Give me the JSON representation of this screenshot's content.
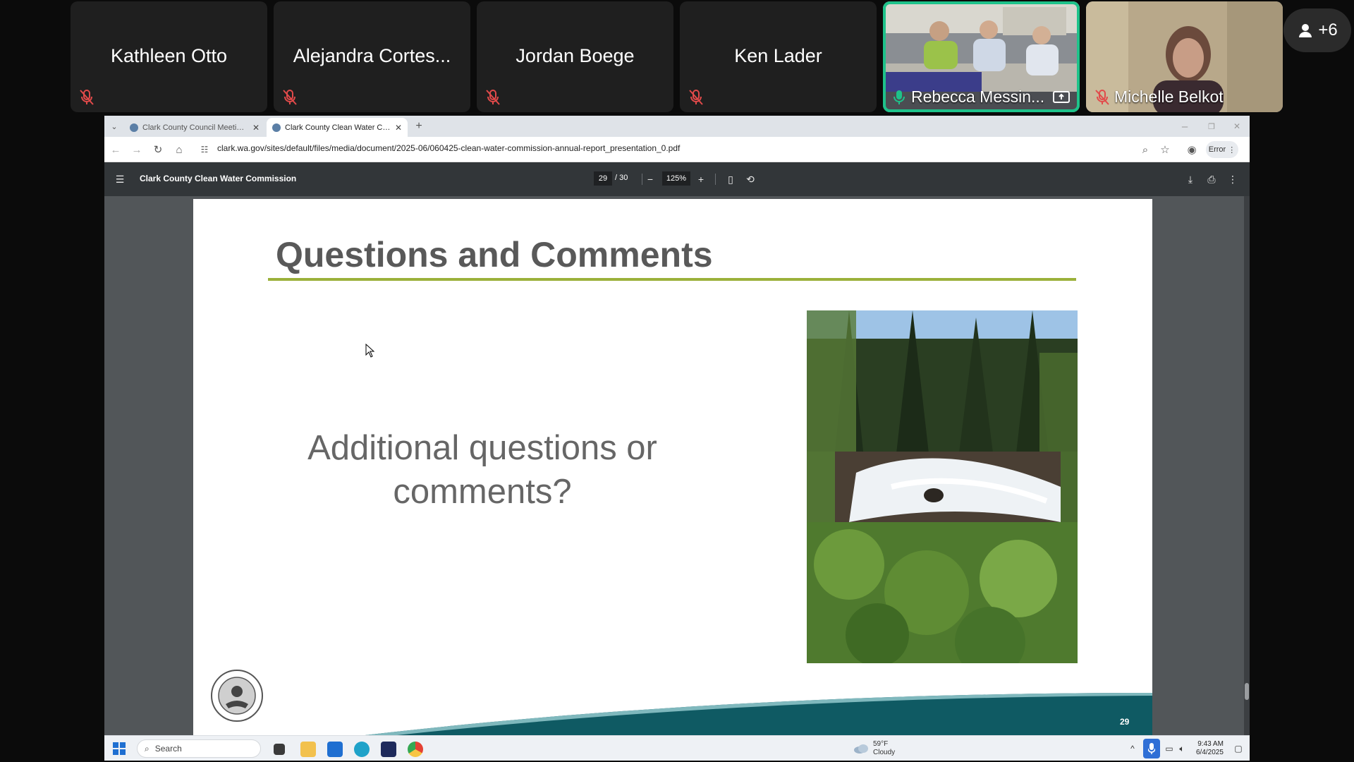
{
  "participants": [
    {
      "name": "Kathleen Otto",
      "muted": true
    },
    {
      "name": "Alejandra Cortes...",
      "muted": true
    },
    {
      "name": "Jordan Boege",
      "muted": true
    },
    {
      "name": "Ken Lader",
      "muted": true
    },
    {
      "name": "Rebecca Messin...",
      "muted": false,
      "video": true,
      "active": true
    },
    {
      "name": "Michelle Belkot",
      "muted": true,
      "video": true
    }
  ],
  "more_participants": "+6",
  "browser": {
    "tabs": [
      {
        "label": "Clark County Council Meetings",
        "active": false
      },
      {
        "label": "Clark County Clean Water Com",
        "active": true
      }
    ],
    "url": "clark.wa.gov/sites/default/files/media/document/2025-06/060425-clean-water-commission-annual-report_presentation_0.pdf",
    "error_label": "Error"
  },
  "pdf": {
    "title": "Clark County Clean Water Commission",
    "page_current": "29",
    "page_total": "/ 30",
    "zoom": "125%"
  },
  "slide": {
    "title": "Questions and Comments",
    "body_line1": "Additional questions or",
    "body_line2": "comments?",
    "page_number": "29"
  },
  "taskbar": {
    "search_placeholder": "Search",
    "weather_temp": "59°F",
    "weather_desc": "Cloudy",
    "time": "9:43 AM",
    "date": "6/4/2025"
  },
  "colors": {
    "active_speaker": "#1ec28a",
    "title_rule": "#9bb13a",
    "slide_wave": "#0f5a63",
    "pdf_toolbar": "#323639"
  }
}
